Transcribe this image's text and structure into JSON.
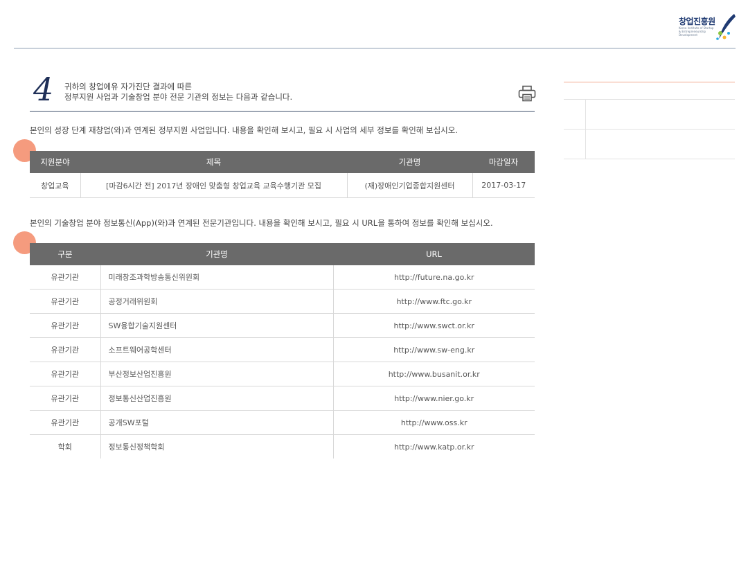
{
  "brand": {
    "logo_name": "창업진흥원",
    "logo_sub": "Korea Institute of Startup & Entrepreneurship Development"
  },
  "section": {
    "number": "4",
    "intro_line1": "귀하의 창업에유 자가진단 결과에 따른",
    "intro_line2": "정부지원 사업과 기술창업 분야 전문 기관의 정보는 다음과 같습니다."
  },
  "gov": {
    "desc": "본인의 성장 단계 재창업(와)과 연계된 정부지원 사업입니다. 내용을 확인해 보시고, 필요 시 사업의 세부 정보를 확인해 보십시오.",
    "headers": [
      "지원분야",
      "제목",
      "기관명",
      "마감일자"
    ],
    "rows": [
      [
        "창업교육",
        "[마감6시간 전] 2017년 장애인 맞춤형 창업교육 교육수행기관 모집",
        "(재)장애인기업종합지원센터",
        "2017-03-17"
      ]
    ]
  },
  "orgs": {
    "desc": "본인의 기술창업 분야 정보통신(App)(와)과 연계된 전문기관입니다. 내용을 확인해 보시고, 필요 시 URL을 통하여 정보를 확인해 보십시오.",
    "headers": [
      "구분",
      "기관명",
      "URL"
    ],
    "rows": [
      [
        "유관기관",
        "미래창조과학방송통신위원회",
        "http://future.na.go.kr"
      ],
      [
        "유관기관",
        "공정거래위원회",
        "http://www.ftc.go.kr"
      ],
      [
        "유관기관",
        "SW융합기술지원센터",
        "http://www.swct.or.kr"
      ],
      [
        "유관기관",
        "소프트웨어공학센터",
        "http://www.sw-eng.kr"
      ],
      [
        "유관기관",
        "부산정보산업진흥원",
        "http://www.busanit.or.kr"
      ],
      [
        "유관기관",
        "정보통신산업진흥원",
        "http://www.nier.go.kr"
      ],
      [
        "유관기관",
        "공개SW포털",
        "http://www.oss.kr"
      ],
      [
        "학회",
        "정보통신정책학회",
        "http://www.katp.or.kr"
      ]
    ]
  },
  "colors": {
    "header_bg": "#6a6a6a",
    "accent_dot": "#f59b7e",
    "navy": "#1f2f57"
  }
}
